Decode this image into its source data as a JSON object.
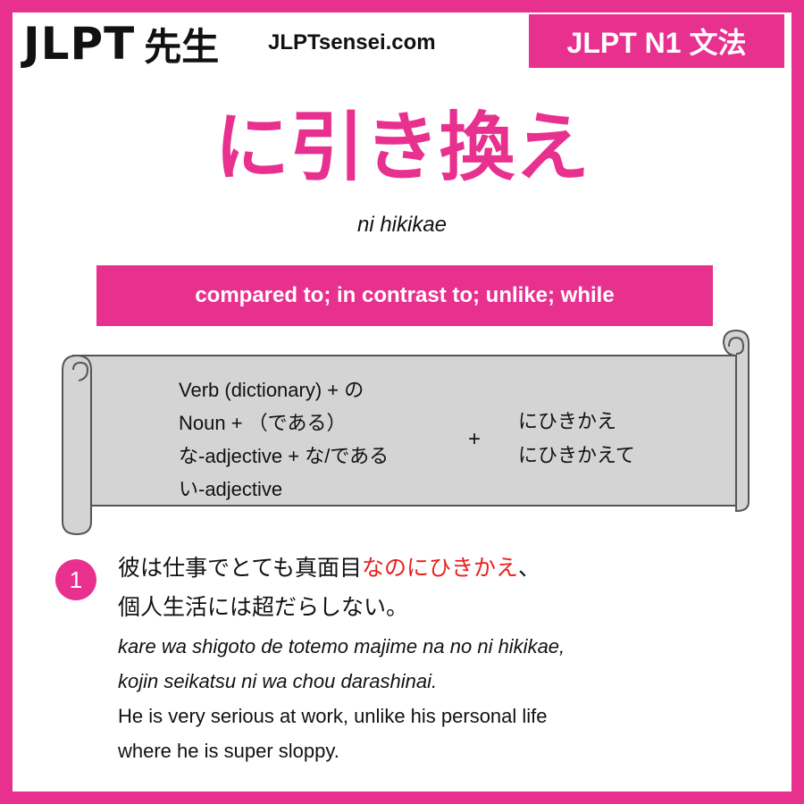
{
  "header": {
    "logo_text": "JLPT",
    "logo_kanji": "先生",
    "site": "JLPTsensei.com",
    "level": "JLPT N1 文法"
  },
  "grammar": {
    "title": "に引き換え",
    "romaji": "ni hikikae",
    "meaning": "compared to; in contrast to; unlike; while"
  },
  "formation": {
    "rules": [
      "Verb (dictionary) + の",
      "Noun + （である）",
      "な-adjective + な/である",
      "い-adjective"
    ],
    "plus": "+",
    "forms": [
      "にひきかえ",
      "にひきかえて"
    ]
  },
  "example": {
    "number": "1",
    "jp_line1_pre": "彼は仕事でとても真面目",
    "jp_line1_hl": "なのにひきかえ",
    "jp_line1_post": "、",
    "jp_line2": "個人生活には超だらしない。",
    "romaji_line1": "kare wa shigoto de totemo majime na no ni hikikae,",
    "romaji_line2": "kojin seikatsu ni wa chou darashinai.",
    "english_line1": "He is very serious at work, unlike his personal life",
    "english_line2": "where he is super sloppy."
  },
  "colors": {
    "accent": "#e8318f",
    "highlight": "#e8201e",
    "scroll_fill": "#d4d4d4",
    "text": "#111111"
  }
}
